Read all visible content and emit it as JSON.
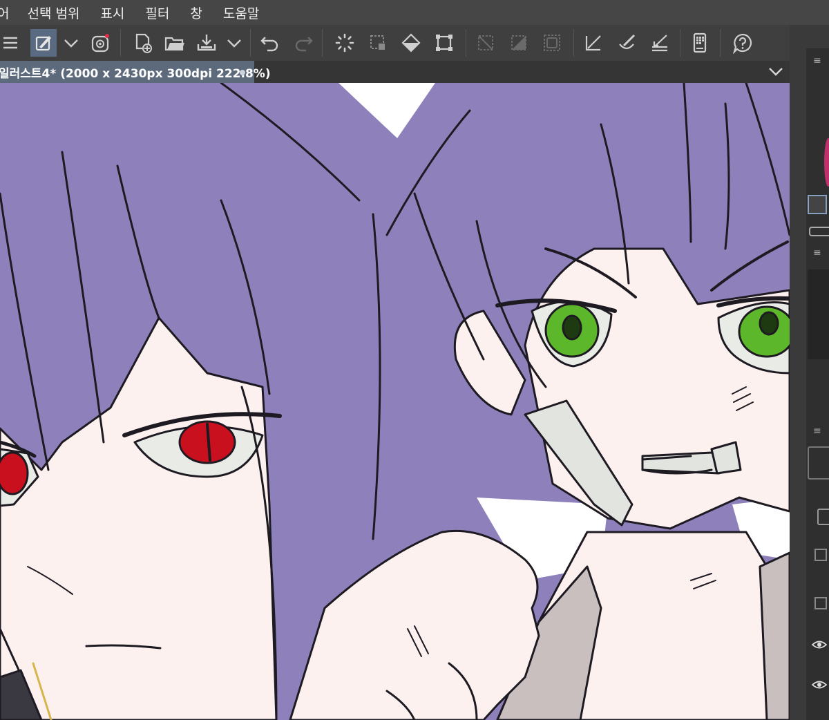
{
  "menu": {
    "items": [
      "어",
      "선택 범위",
      "표시",
      "필터",
      "창",
      "도움말"
    ]
  },
  "toolbar": {
    "buttons": [
      {
        "name": "menu-icon",
        "label": "Main menu"
      },
      {
        "name": "brush-tool-icon",
        "label": "Tool"
      },
      {
        "name": "chevron-down-icon",
        "label": "More"
      },
      {
        "name": "record-icon",
        "label": "Record"
      },
      {
        "name": "new-file-icon",
        "label": "New"
      },
      {
        "name": "open-folder-icon",
        "label": "Open"
      },
      {
        "name": "save-icon",
        "label": "Save"
      },
      {
        "name": "undo-icon",
        "label": "Undo"
      },
      {
        "name": "redo-icon",
        "label": "Redo"
      },
      {
        "name": "loading-icon",
        "label": "Processing"
      },
      {
        "name": "selection-icon",
        "label": "Selection"
      },
      {
        "name": "fill-icon",
        "label": "Fill"
      },
      {
        "name": "transform-icon",
        "label": "Transform"
      },
      {
        "name": "clear-selection-icon",
        "label": "Clear"
      },
      {
        "name": "invert-selection-icon",
        "label": "Invert"
      },
      {
        "name": "select-all-icon",
        "label": "Select all"
      },
      {
        "name": "ruler-icon",
        "label": "Ruler"
      },
      {
        "name": "brush-stroke-icon",
        "label": "Brush"
      },
      {
        "name": "eraser-icon",
        "label": "Eraser"
      },
      {
        "name": "phone-icon",
        "label": "Companion"
      },
      {
        "name": "help-icon",
        "label": "Help"
      }
    ]
  },
  "tab": {
    "title": "일러스트4* (2000 x 2430px 300dpi 222.8%)"
  },
  "colors": {
    "hair": "#8d80bb",
    "skin": "#fdf1ef",
    "red_eye": "#c8101e",
    "green_eye": "#5cb82a",
    "active_tab": "#5c6a7c",
    "menubar": "#464646"
  }
}
